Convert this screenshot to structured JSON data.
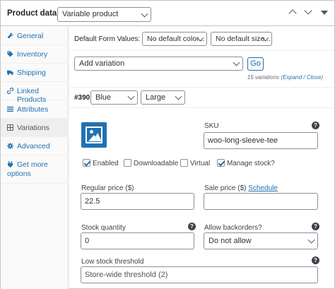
{
  "header": {
    "title": "Product data —",
    "product_type": "Variable product"
  },
  "sidebar": {
    "items": [
      {
        "label": "General",
        "icon": "wrench-icon"
      },
      {
        "label": "Inventory",
        "icon": "tag-icon"
      },
      {
        "label": "Shipping",
        "icon": "truck-icon"
      },
      {
        "label": "Linked Products",
        "icon": "link-icon"
      },
      {
        "label": "Attributes",
        "icon": "list-icon"
      },
      {
        "label": "Variations",
        "icon": "grid-icon",
        "active": true
      },
      {
        "label": "Advanced",
        "icon": "gear-icon"
      },
      {
        "label": "Get more options",
        "icon": "plugin-icon"
      }
    ]
  },
  "defaults": {
    "label": "Default Form Values:",
    "color": "No default color...",
    "size": "No default size..."
  },
  "add_variation": {
    "select": "Add variation",
    "go": "Go"
  },
  "variations_count": {
    "text": "15 variations",
    "expand": "Expand",
    "sep": " / ",
    "close": "Close"
  },
  "variation": {
    "id": "#390",
    "color": "Blue",
    "size": "Large",
    "sku_label": "SKU",
    "sku": "woo-long-sleeve-tee",
    "enabled": "Enabled",
    "downloadable": "Downloadable",
    "virtual": "Virtual",
    "manage_stock": "Manage stock?",
    "regular_price_label": "Regular price ($)",
    "regular_price": "22.5",
    "sale_price_label": "Sale price ($)",
    "schedule": "Schedule",
    "stock_qty_label": "Stock quantity",
    "stock_qty": "0",
    "backorders_label": "Allow backorders?",
    "backorders": "Do not allow",
    "low_stock_label": "Low stock threshold",
    "low_stock_placeholder": "Store-wide threshold (2)"
  },
  "colors": {
    "accent": "#2271b1",
    "text": "#1d2327",
    "border": "#8c8f94"
  }
}
